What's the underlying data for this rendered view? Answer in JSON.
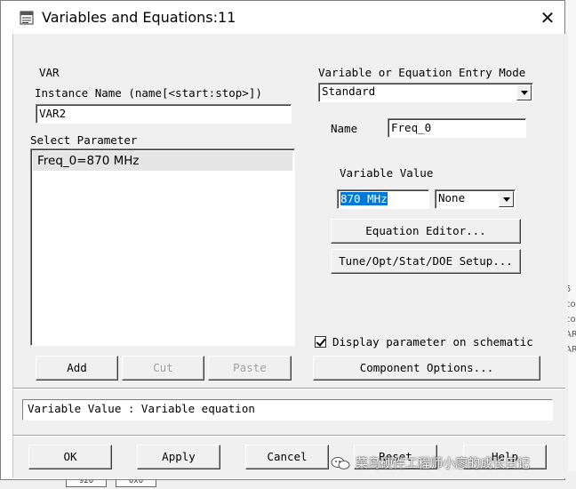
{
  "window": {
    "title": "Variables and Equations:11",
    "close_glyph": "✕"
  },
  "component": {
    "type_label": "VAR"
  },
  "instance": {
    "label": "Instance Name  (name[<start:stop>])",
    "value": "VAR2"
  },
  "select_parameter": {
    "label": "Select Parameter",
    "items": [
      "Freq_0=870 MHz"
    ],
    "selected_index": 0
  },
  "list_buttons": {
    "add": "Add",
    "cut": "Cut",
    "paste": "Paste"
  },
  "entry_mode": {
    "label": "Variable or Equation Entry Mode",
    "value": "Standard"
  },
  "name_field": {
    "label": "Name",
    "value": "Freq_0"
  },
  "variable_value": {
    "label": "Variable Value",
    "value": "870 MHz",
    "unit": "None"
  },
  "buttons": {
    "equation_editor": "Equation Editor...",
    "tune_setup": "Tune/Opt/Stat/DOE Setup...",
    "component_options": "Component Options...",
    "ok": "OK",
    "apply": "Apply",
    "cancel": "Cancel",
    "reset": "Reset",
    "help": "Help"
  },
  "display_checkbox": {
    "label": "Display parameter on schematic",
    "checked": true
  },
  "status_text": "Variable Value : Variable equation",
  "watermark": "菜鸟硬件工程师小廖的成长日记",
  "background": {
    "right_marks": [
      "5",
      "co",
      "co",
      "AR",
      "AR"
    ],
    "bottom_cells": [
      "920",
      "0x0"
    ]
  },
  "colors": {
    "dialog_face": "#f0f0f0",
    "selection": "#0078d7",
    "list_highlight": "#e5e5e5"
  }
}
